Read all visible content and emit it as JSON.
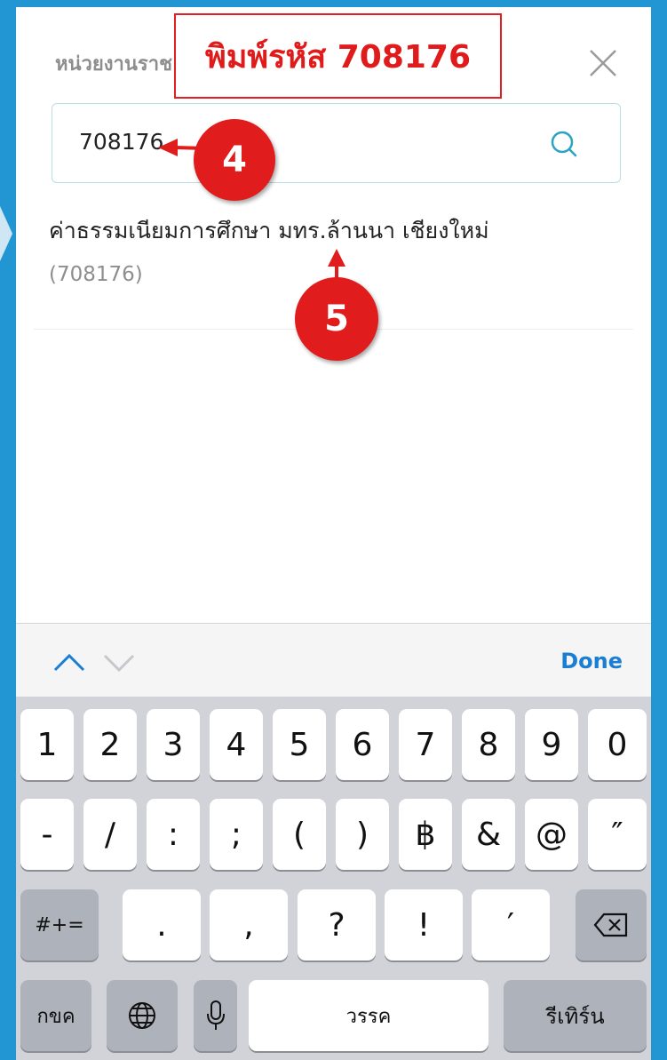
{
  "header": {
    "title": "หน่วยงานราช"
  },
  "search": {
    "value": "708176"
  },
  "result": {
    "name": "ค่าธรรมเนียมการศึกษา มทร.ล้านนา เชียงใหม่",
    "code": "(708176)"
  },
  "callout": {
    "text": "พิมพ์รหัส 708176"
  },
  "steps": {
    "four": "4",
    "five": "5"
  },
  "accessory": {
    "done_label": "Done"
  },
  "keyboard": {
    "row1": [
      "1",
      "2",
      "3",
      "4",
      "5",
      "6",
      "7",
      "8",
      "9",
      "0"
    ],
    "row2": [
      "-",
      "/",
      ":",
      ";",
      "(",
      ")",
      "฿",
      "&",
      "@",
      "″"
    ],
    "row3": [
      "#+=",
      ".",
      ",",
      "?",
      "!",
      "′"
    ],
    "row4": {
      "lang": "กขค",
      "space": "วรรค",
      "return": "รีเทิร์น"
    }
  },
  "colors": {
    "background": "#2196d3",
    "accent": "#1a7fd4",
    "callout_red": "#e11c1c"
  }
}
